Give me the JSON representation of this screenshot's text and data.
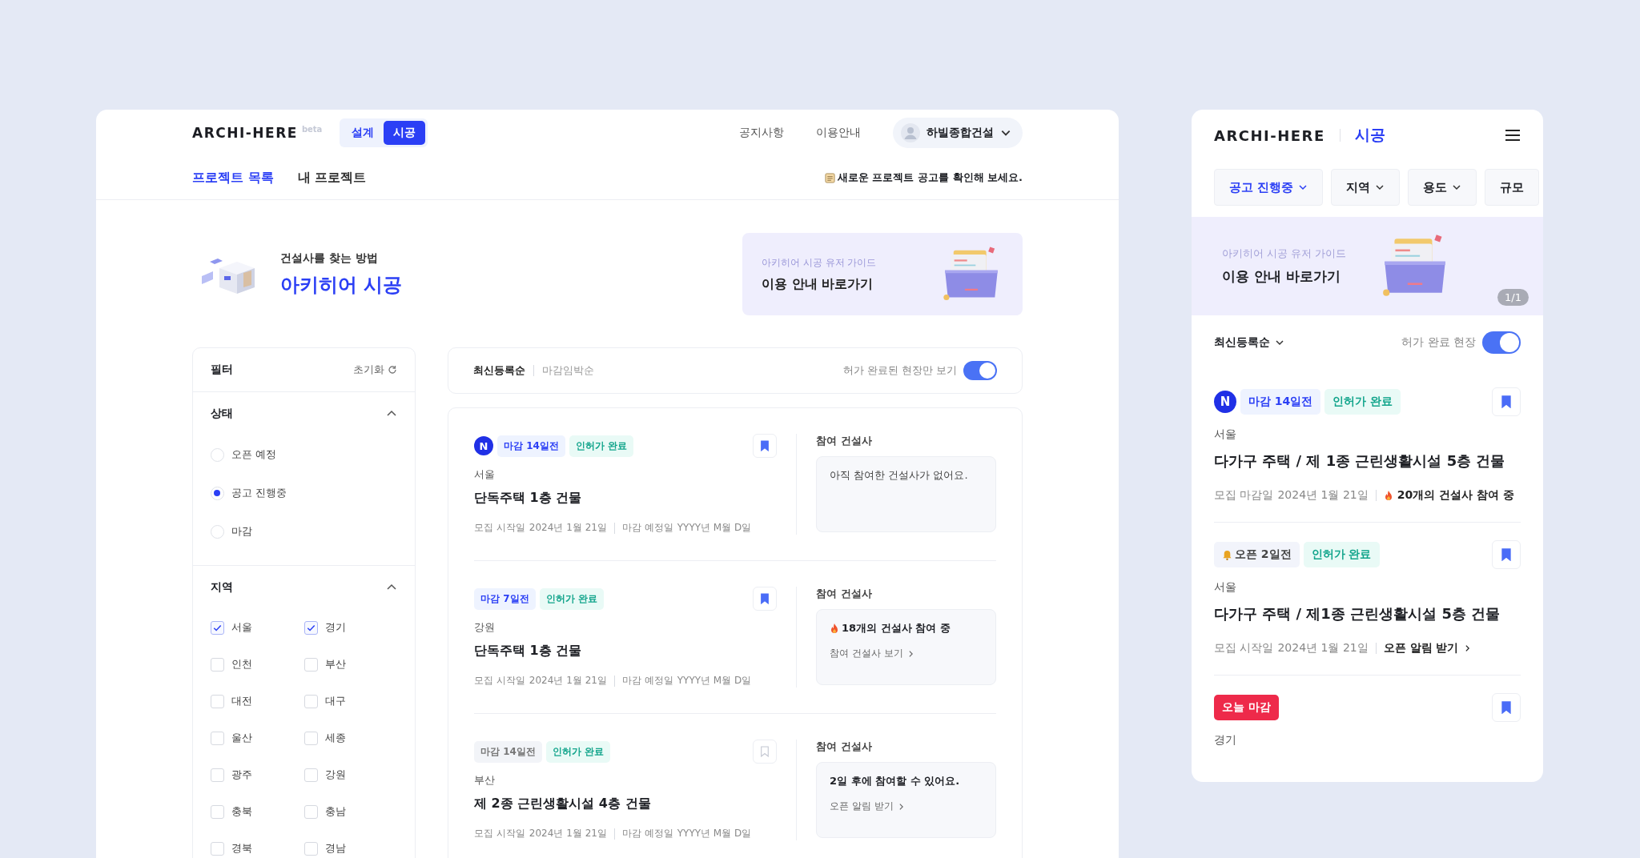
{
  "desktop": {
    "logo": "ARCHI-HERE",
    "logo_badge": "beta",
    "mode_tabs": [
      {
        "label": "설계",
        "selected": false
      },
      {
        "label": "시공",
        "selected": true
      }
    ],
    "nav_links": [
      "공지사항",
      "이용안내"
    ],
    "user": {
      "name": "하빌종합건설"
    },
    "tabs": [
      {
        "label": "프로젝트 목록",
        "selected": true
      },
      {
        "label": "내 프로젝트",
        "selected": false
      }
    ],
    "notice": "새로운 프로젝트 공고를 확인해 보세요.",
    "hero": {
      "subtitle": "건설사를 찾는 방법",
      "title": "아키히어 시공"
    },
    "guide_banner": {
      "caption": "아키히어 시공 유저 가이드",
      "title": "이용 안내 바로가기"
    },
    "filter": {
      "title": "필터",
      "reset": "초기화",
      "sections": [
        {
          "title": "상태",
          "expanded": true,
          "kind": "radio",
          "options": [
            {
              "label": "오픈 예정",
              "selected": false
            },
            {
              "label": "공고 진행중",
              "selected": true
            },
            {
              "label": "마감",
              "selected": false
            }
          ]
        },
        {
          "title": "지역",
          "expanded": true,
          "kind": "checkbox",
          "options": [
            {
              "label": "서울",
              "selected": true
            },
            {
              "label": "경기",
              "selected": true
            },
            {
              "label": "인천",
              "selected": false
            },
            {
              "label": "부산",
              "selected": false
            },
            {
              "label": "대전",
              "selected": false
            },
            {
              "label": "대구",
              "selected": false
            },
            {
              "label": "울산",
              "selected": false
            },
            {
              "label": "세종",
              "selected": false
            },
            {
              "label": "광주",
              "selected": false
            },
            {
              "label": "강원",
              "selected": false
            },
            {
              "label": "충북",
              "selected": false
            },
            {
              "label": "충남",
              "selected": false
            },
            {
              "label": "경북",
              "selected": false
            },
            {
              "label": "경남",
              "selected": false
            }
          ]
        }
      ]
    },
    "sort": [
      {
        "label": "최신등록순",
        "selected": true
      },
      {
        "label": "마감임박순",
        "selected": false
      }
    ],
    "permit_toggle": {
      "label": "허가 완료된 현장만 보기",
      "on": true
    },
    "projects": [
      {
        "new_badge": "N",
        "badges": [
          {
            "kind": "deadline",
            "text": "마감 14일전"
          },
          {
            "kind": "permit",
            "text": "인허가 완료"
          }
        ],
        "bookmarked": true,
        "region": "서울",
        "title": "단독주택 1층 건물",
        "start_label": "모집 시작일",
        "start_date": "2024년 1월 21일",
        "due_label": "마감 예정일",
        "due_date": "YYYY년 M월 D일",
        "participants": {
          "label": "참여 건설사",
          "kind": "empty",
          "text": "아직 참여한 건설사가 없어요."
        }
      },
      {
        "badges": [
          {
            "kind": "deadline",
            "text": "마감 7일전"
          },
          {
            "kind": "permit",
            "text": "인허가 완료"
          }
        ],
        "bookmarked": true,
        "region": "강원",
        "title": "단독주택 1층 건물",
        "start_label": "모집 시작일",
        "start_date": "2024년 1월 21일",
        "due_label": "마감 예정일",
        "due_date": "YYYY년 M월 D일",
        "participants": {
          "label": "참여 건설사",
          "kind": "count",
          "text": "18개의 건설사 참여 중",
          "link": "참여 건설사 보기"
        }
      },
      {
        "badges": [
          {
            "kind": "deadline-muted",
            "text": "마감 14일전"
          },
          {
            "kind": "permit",
            "text": "인허가 완료"
          }
        ],
        "bookmarked": false,
        "region": "부산",
        "title": "제 2종 근린생활시설 4층 건물",
        "start_label": "모집 시작일",
        "start_date": "2024년 1월 21일",
        "due_label": "마감 예정일",
        "due_date": "YYYY년 M월 D일",
        "participants": {
          "label": "참여 건설사",
          "kind": "upcoming",
          "text": "2일 후에 참여할 수 있어요.",
          "link": "오픈 알림 받기"
        }
      }
    ]
  },
  "mobile": {
    "logo": "ARCHI-HERE",
    "section": "시공",
    "filters": [
      {
        "label": "공고 진행중",
        "selected": true
      },
      {
        "label": "지역",
        "selected": false
      },
      {
        "label": "용도",
        "selected": false
      },
      {
        "label": "규모",
        "selected": false
      }
    ],
    "guide_banner": {
      "caption": "아키히어 시공 유저 가이드",
      "title": "이용 안내 바로가기",
      "pager": "1/1"
    },
    "sort": "최신등록순",
    "permit_toggle": {
      "label": "허가 완료 현장",
      "on": true
    },
    "projects": [
      {
        "new_badge": "N",
        "badges": [
          {
            "kind": "deadline",
            "text": "마감 14일전"
          },
          {
            "kind": "permit",
            "text": "인허가 완료"
          }
        ],
        "bookmarked": true,
        "region": "서울",
        "title": "다가구 주택 / 제 1종 근린생활시설 5층 건물",
        "meta_label": "모집 마감일",
        "meta_date": "2024년 1월 21일",
        "extra": {
          "kind": "count",
          "text": "20개의 건설사 참여 중"
        }
      },
      {
        "badges": [
          {
            "kind": "open",
            "text": "오픈 2일전"
          },
          {
            "kind": "permit",
            "text": "인허가 완료"
          }
        ],
        "bookmarked": true,
        "region": "서울",
        "title": "다가구 주택 / 제1종 근린생활시설 5층 건물",
        "meta_label": "모집 시작일",
        "meta_date": "2024년 1월 21일",
        "extra": {
          "kind": "link",
          "text": "오픈 알림 받기"
        }
      },
      {
        "badges": [
          {
            "kind": "today",
            "text": "오늘 마감"
          }
        ],
        "bookmarked": true,
        "region": "경기"
      }
    ]
  }
}
